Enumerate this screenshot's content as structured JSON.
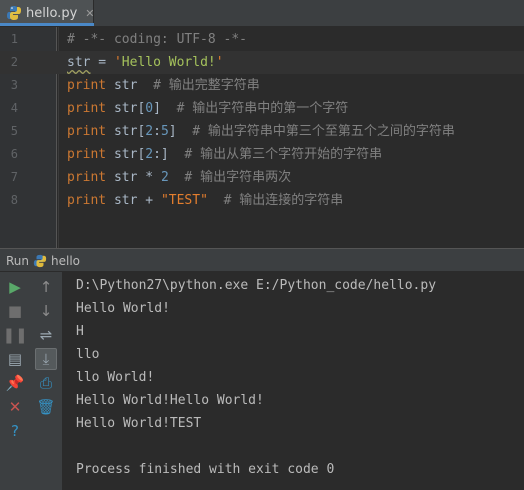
{
  "tab": {
    "filename": "hello.py",
    "close_glyph": "✕"
  },
  "editor": {
    "lines": [
      {
        "num": "1",
        "segments": [
          {
            "text": "# -*- coding: UTF-8 -*-",
            "cls": "cm"
          }
        ]
      },
      {
        "num": "2",
        "current": true,
        "segments": [
          {
            "text": "str",
            "cls": "op squiggle"
          },
          {
            "text": " = ",
            "cls": "op"
          },
          {
            "text": "'",
            "cls": "strmark"
          },
          {
            "text": "Hello World!",
            "cls": "str"
          },
          {
            "text": "'",
            "cls": "strmark"
          }
        ]
      },
      {
        "num": "3",
        "segments": [
          {
            "text": "print",
            "cls": "kw"
          },
          {
            "text": " str  ",
            "cls": "op"
          },
          {
            "text": "# ",
            "cls": "cm"
          },
          {
            "text": "输出完整字符串",
            "cls": "cm cjk"
          }
        ]
      },
      {
        "num": "4",
        "segments": [
          {
            "text": "print",
            "cls": "kw"
          },
          {
            "text": " str[",
            "cls": "op"
          },
          {
            "text": "0",
            "cls": "num"
          },
          {
            "text": "]  ",
            "cls": "op"
          },
          {
            "text": "# ",
            "cls": "cm"
          },
          {
            "text": "输出字符串中的第一个字符",
            "cls": "cm cjk"
          }
        ]
      },
      {
        "num": "5",
        "segments": [
          {
            "text": "print",
            "cls": "kw"
          },
          {
            "text": " str[",
            "cls": "op"
          },
          {
            "text": "2",
            "cls": "num"
          },
          {
            "text": ":",
            "cls": "op"
          },
          {
            "text": "5",
            "cls": "num"
          },
          {
            "text": "]  ",
            "cls": "op"
          },
          {
            "text": "# ",
            "cls": "cm"
          },
          {
            "text": "输出字符串中第三个至第五个之间的字符串",
            "cls": "cm cjk"
          }
        ]
      },
      {
        "num": "6",
        "segments": [
          {
            "text": "print",
            "cls": "kw"
          },
          {
            "text": " str[",
            "cls": "op"
          },
          {
            "text": "2",
            "cls": "num"
          },
          {
            "text": ":]  ",
            "cls": "op"
          },
          {
            "text": "# ",
            "cls": "cm"
          },
          {
            "text": "输出从第三个字符开始的字符串",
            "cls": "cm cjk"
          }
        ]
      },
      {
        "num": "7",
        "segments": [
          {
            "text": "print",
            "cls": "kw"
          },
          {
            "text": " str * ",
            "cls": "op"
          },
          {
            "text": "2",
            "cls": "num"
          },
          {
            "text": "  ",
            "cls": "op"
          },
          {
            "text": "# ",
            "cls": "cm"
          },
          {
            "text": "输出字符串两次",
            "cls": "cm cjk"
          }
        ]
      },
      {
        "num": "8",
        "segments": [
          {
            "text": "print",
            "cls": "kw"
          },
          {
            "text": " str + ",
            "cls": "op"
          },
          {
            "text": "\"TEST\"",
            "cls": "strmark"
          },
          {
            "text": "  ",
            "cls": "op"
          },
          {
            "text": "# ",
            "cls": "cm"
          },
          {
            "text": "输出连接的字符串",
            "cls": "cm cjk"
          }
        ]
      }
    ]
  },
  "run_panel": {
    "title": "Run",
    "config_name": "hello",
    "output": [
      "D:\\Python27\\python.exe E:/Python_code/hello.py",
      "Hello World!",
      "H",
      "llo",
      "llo World!",
      "Hello World!Hello World!",
      "Hello World!TEST",
      "",
      "Process finished with exit code 0"
    ],
    "left_tools": [
      {
        "name": "rerun-icon",
        "glyph": "▶",
        "color": "#59a869"
      },
      {
        "name": "stop-icon",
        "glyph": "■",
        "color": "#6e6e6e"
      },
      {
        "name": "pause-icon",
        "glyph": "❚❚",
        "color": "#6e6e6e"
      },
      {
        "name": "dump-threads-icon",
        "glyph": "▤",
        "color": "#9aa7b0"
      },
      {
        "name": "pin-icon",
        "glyph": "📌",
        "color": "#c75450"
      },
      {
        "name": "close-icon",
        "glyph": "✕",
        "color": "#c75450"
      },
      {
        "name": "help-icon",
        "glyph": "?",
        "color": "#3592c4"
      }
    ],
    "right_tools": [
      {
        "name": "scroll-up-icon",
        "glyph": "↑",
        "color": "#8c8c8c"
      },
      {
        "name": "scroll-down-icon",
        "glyph": "↓",
        "color": "#8c8c8c"
      },
      {
        "name": "soft-wrap-icon",
        "glyph": "⇌",
        "color": "#9aa7b0"
      },
      {
        "name": "scroll-to-end-icon",
        "glyph": "⤓",
        "color": "#9aa7b0",
        "pressed": true
      },
      {
        "name": "print-icon",
        "glyph": "⎙",
        "color": "#3592c4"
      },
      {
        "name": "clear-all-icon",
        "glyph": "🗑",
        "color": "#3592c4"
      }
    ]
  },
  "colors": {
    "accent": "#4a88c7",
    "background": "#2b2b2b",
    "panel": "#3c3f41"
  }
}
